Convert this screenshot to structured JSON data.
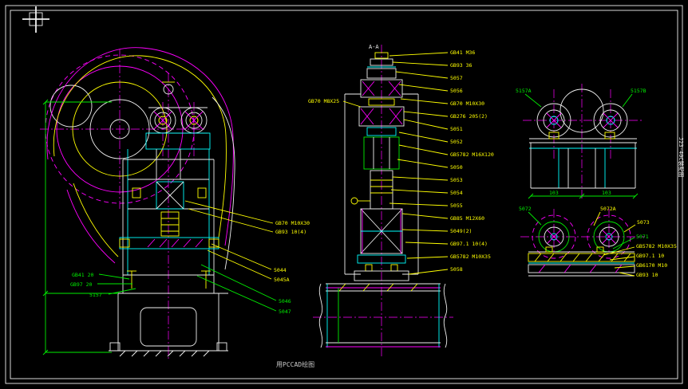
{
  "palette": {
    "background": "#000000",
    "outline_white": "#f0f0f0",
    "cad_cyan": "#00ffff",
    "cad_magenta": "#ff00ff",
    "cad_yellow": "#ffff00",
    "cad_green": "#00ee00"
  },
  "frame": {
    "watermark": "用PCCAD绘图",
    "vertical_title": "J23-40C装配图",
    "section_label": "A-A"
  },
  "front_view": {
    "left_labels": [
      "GB41 20",
      "GB97 20",
      "5157"
    ],
    "right_labels": [
      "GB70 M10X30",
      "GB93 10(4)",
      "5044",
      "5045A",
      "5046",
      "5047"
    ]
  },
  "side_view": {
    "left_label": "GB70 M8X25",
    "callouts": [
      "GB41 M36",
      "GB93 36",
      "5057",
      "5056",
      "GB70 M10X30",
      "GB276 205(2)",
      "5051",
      "5052",
      "GB5782 M16X120",
      "5050",
      "5053",
      "5054",
      "5055",
      "GB85 M12X60",
      "5049(2)",
      "GB97.1 10(4)",
      "GB5782 M10X35",
      "5058"
    ]
  },
  "top_detail": {
    "label_left": "5157A",
    "label_right": "5157B",
    "dim_left": "103",
    "dim_right": "103"
  },
  "bottom_detail": {
    "label_left": "5072",
    "label_mid": "5072A",
    "label_right": "5073",
    "callouts": [
      "5071",
      "GB5782 M10X35",
      "GB97.1 10",
      "GB6170 M10",
      "GB93 10"
    ]
  }
}
